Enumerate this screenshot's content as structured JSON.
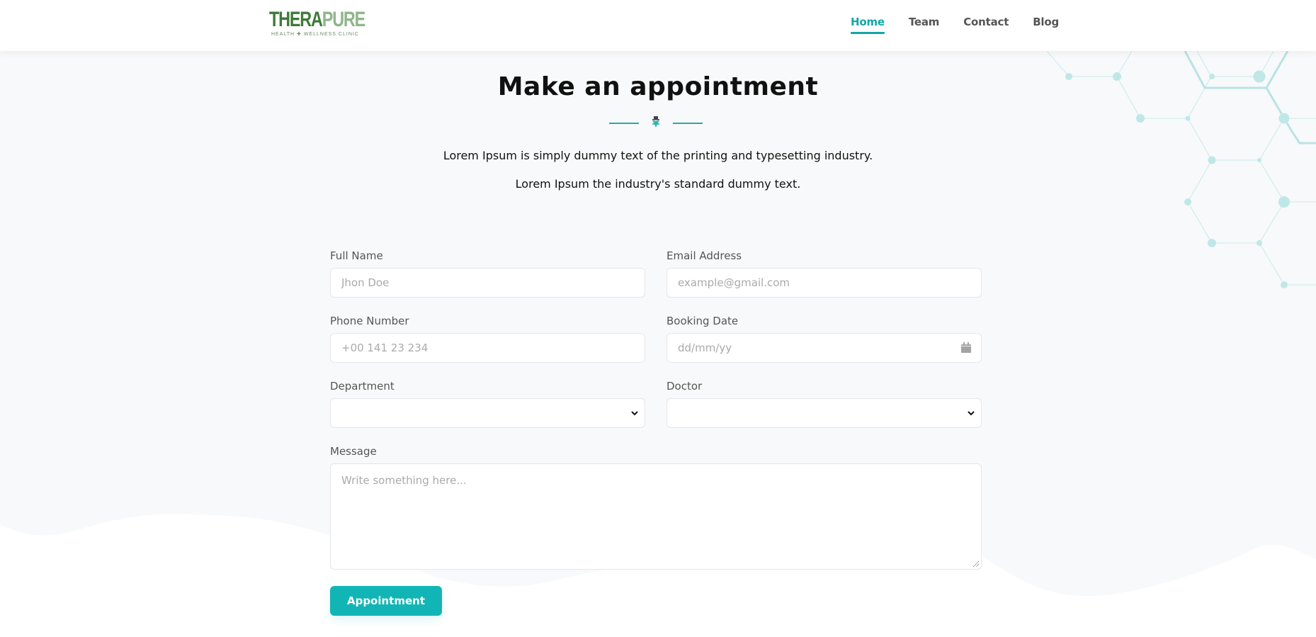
{
  "header": {
    "logo": {
      "word_dark": "THERA",
      "word_light": "PURE",
      "tagline": "HEALTH ✚ WELLNESS  CLINIC"
    },
    "nav": [
      {
        "label": "Home",
        "active": true
      },
      {
        "label": "Team",
        "active": false
      },
      {
        "label": "Contact",
        "active": false
      },
      {
        "label": "Blog",
        "active": false
      }
    ]
  },
  "hero": {
    "title": "Make an appointment",
    "divider_icon": "medical-logo-icon",
    "subtitle_1": "Lorem Ipsum is simply dummy text of the printing and typesetting industry.",
    "subtitle_2": "Lorem Ipsum the industry's standard dummy text."
  },
  "form": {
    "full_name": {
      "label": "Full Name",
      "placeholder": "Jhon Doe",
      "value": ""
    },
    "email": {
      "label": "Email Address",
      "placeholder": "example@gmail.com",
      "value": ""
    },
    "phone": {
      "label": "Phone Number",
      "placeholder": "+00 141 23 234",
      "value": ""
    },
    "booking_date": {
      "label": "Booking Date",
      "placeholder": "dd/mm/yy",
      "value": "",
      "icon": "calendar-icon"
    },
    "department": {
      "label": "Department",
      "selected": ""
    },
    "doctor": {
      "label": "Doctor",
      "selected": ""
    },
    "message": {
      "label": "Message",
      "placeholder": "Write something here...",
      "value": ""
    },
    "submit_label": "Appointment"
  },
  "colors": {
    "accent": "#14a6a6",
    "button": "#12b5b5",
    "logo_dark": "#3f7a3a",
    "logo_light": "#8fb58a",
    "background": "#f8f9fa"
  }
}
